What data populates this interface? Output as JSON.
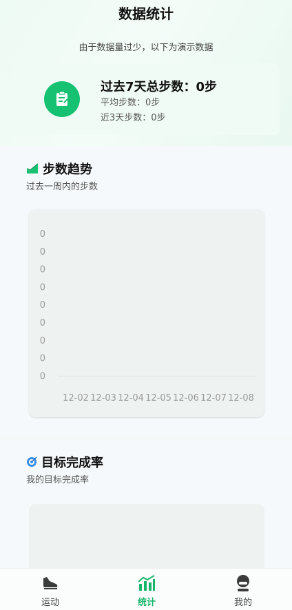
{
  "header": {
    "title": "数据统计"
  },
  "notice": "由于数据量过少，以下为演示数据",
  "summary": {
    "icon": "clipboard-icon",
    "total": "过去7天总步数：0步",
    "average": "平均步数：0步",
    "recent": "近3天步数：0步"
  },
  "trend": {
    "icon": "chart-rising-icon",
    "title": "步数趋势",
    "subtitle": "过去一周内的步数"
  },
  "chart_data": {
    "type": "bar",
    "categories": [
      "12-02",
      "12-03",
      "12-04",
      "12-05",
      "12-06",
      "12-07",
      "12-08"
    ],
    "values": [
      0,
      0,
      0,
      0,
      0,
      0,
      0
    ],
    "y_tick_labels": [
      "0",
      "0",
      "0",
      "0",
      "0",
      "0",
      "0",
      "0",
      "0"
    ],
    "title": "",
    "xlabel": "",
    "ylabel": ""
  },
  "goal": {
    "icon": "target-icon",
    "title": "目标完成率",
    "subtitle": "我的目标完成率"
  },
  "tabbar": {
    "items": [
      {
        "label": "运动",
        "icon": "sneaker-icon",
        "active": false
      },
      {
        "label": "统计",
        "icon": "bar-chart-icon",
        "active": true
      },
      {
        "label": "我的",
        "icon": "user-icon",
        "active": false
      }
    ],
    "active_color": "#16b56a"
  },
  "colors": {
    "accent": "#16c171"
  }
}
